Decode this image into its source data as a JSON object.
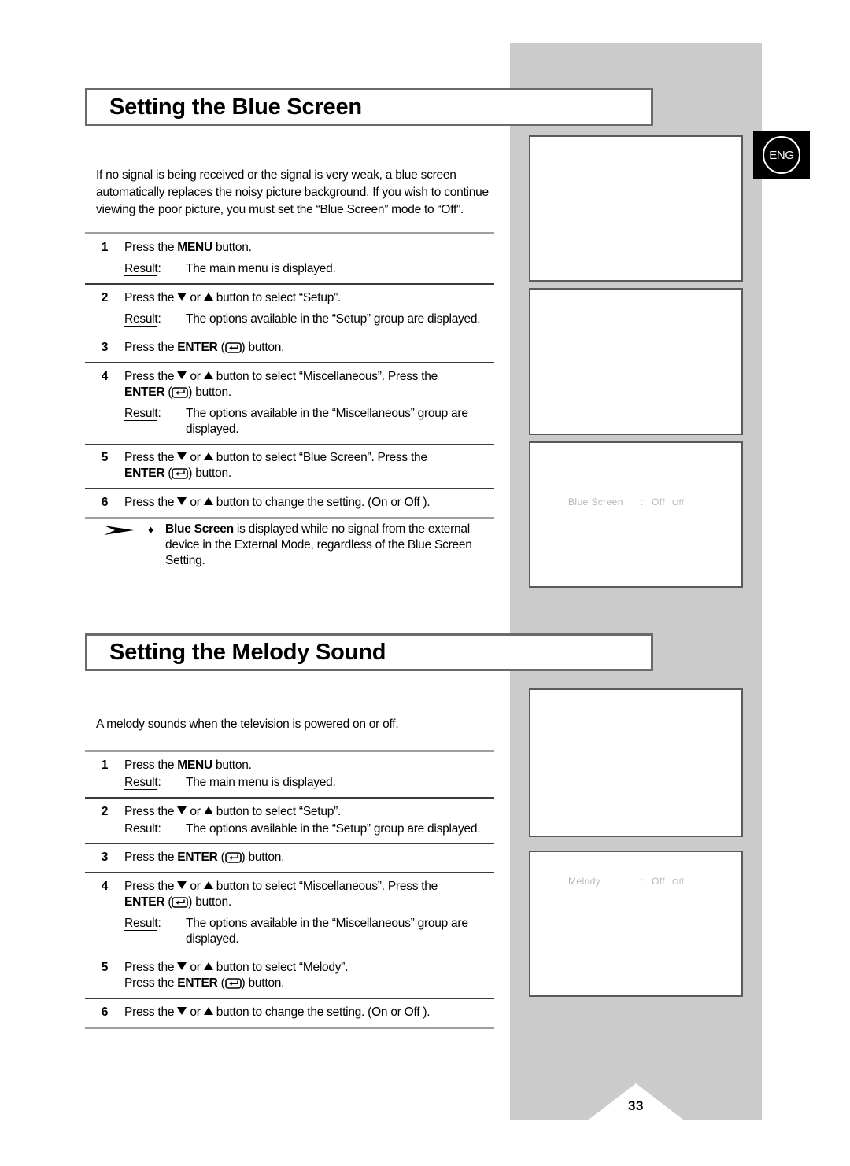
{
  "page": {
    "number": "33",
    "language_badge": "ENG"
  },
  "sections": [
    {
      "heading": "Setting the Blue Screen",
      "intro": "If no signal is being received or the signal is very weak, a blue screen automatically replaces the noisy picture background. If you wish to continue viewing the poor picture, you must set the “Blue Screen” mode to “Off”.",
      "steps": [
        {
          "num": "1",
          "line1_pre": "Press the ",
          "line1_bold": "MENU",
          "line1_post": " button.",
          "result_label": "Result",
          "result_text": "The main menu is displayed."
        },
        {
          "num": "2",
          "line1_pre": "Press the ",
          "line1_mid": " or ",
          "line1_post": " button to select “Setup”.",
          "result_label": "Result",
          "result_text": "The options available in the “Setup” group are displayed."
        },
        {
          "num": "3",
          "line1_pre": "Press the ",
          "line1_bold": "ENTER",
          "line1_post": " button."
        },
        {
          "num": "4",
          "line1_pre": "Press the ",
          "line1_mid": " or ",
          "line1_post": " button to select “Miscellaneous”. Press the",
          "line2_bold": "ENTER",
          "line2_post": " button.",
          "result_label": "Result",
          "result_text": "The options available in the “Miscellaneous” group are displayed."
        },
        {
          "num": "5",
          "line1_pre": "Press the ",
          "line1_mid": " or ",
          "line1_post": " button to select “Blue Screen”. Press the",
          "line2_bold": "ENTER",
          "line2_post": " button."
        },
        {
          "num": "6",
          "line1_pre": "Press the ",
          "line1_mid": " or ",
          "line1_post": " button to change the setting. (On or Off )."
        }
      ]
    },
    {
      "heading": "Setting the Melody Sound",
      "intro": "A melody sounds when the television is powered on or off.",
      "steps": [
        {
          "num": "1",
          "line1_pre": "Press the ",
          "line1_bold": "MENU",
          "line1_post": " button.",
          "result_label": "Result",
          "result_text": "The main menu is displayed."
        },
        {
          "num": "2",
          "line1_pre": "Press the ",
          "line1_mid": " or ",
          "line1_post": " button to select “Setup”.",
          "result_label": "Result",
          "result_text": "The options available in the “Setup” group are displayed."
        },
        {
          "num": "3",
          "line1_pre": "Press the ",
          "line1_bold": "ENTER",
          "line1_post": " button."
        },
        {
          "num": "4",
          "line1_pre": "Press the ",
          "line1_mid": " or ",
          "line1_post": " button to select “Miscellaneous”. Press the",
          "line2_bold": "ENTER",
          "line2_post": " button.",
          "result_label": "Result",
          "result_text": "The options available in the “Miscellaneous” group are displayed."
        },
        {
          "num": "5",
          "line1_pre": "Press the ",
          "line1_mid": " or ",
          "line1_post": " button to select “Melody”.",
          "line2_pre": "Press the ",
          "line2_bold": "ENTER",
          "line2_post": " button."
        },
        {
          "num": "6",
          "line1_pre": "Press the ",
          "line1_mid": " or ",
          "line1_post": " button to change the setting. (On or Off )."
        }
      ]
    }
  ],
  "note": {
    "arrow_icon": "note-arrow-icon",
    "bullet": "♦",
    "bold_lead": "Blue Screen",
    "text": " is displayed while no signal from the external device in the External Mode, regardless of the Blue Screen Setting."
  },
  "osd_screens": {
    "blue_screen": {
      "label": "Blue Screen",
      "colon": ":",
      "value": "Off",
      "value_small": "Off"
    },
    "melody": {
      "label": "Melody",
      "colon": ":",
      "value": "Off",
      "value_small": "Off"
    }
  }
}
